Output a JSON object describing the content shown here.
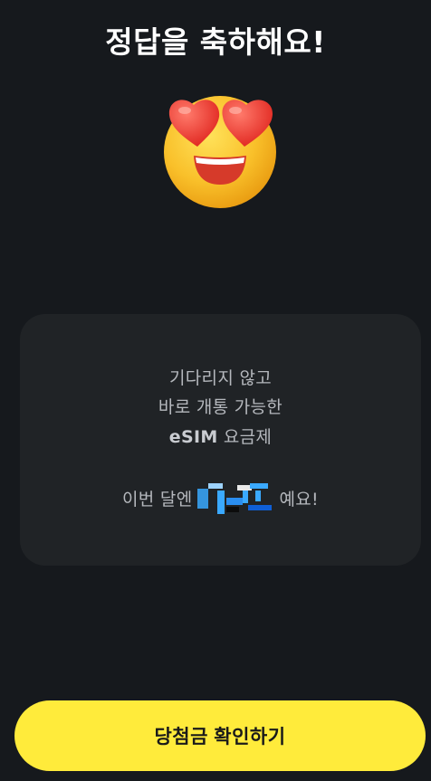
{
  "title": "정답을 축하해요!",
  "emoji": {
    "icon": "heart-eyes-emoji"
  },
  "card": {
    "line1": "기다리지 않고",
    "line2": "바로 개통 가능한",
    "line3_bold": "eSIM",
    "line3_rest": " 요금제",
    "line4_prefix": "이번 달엔 ",
    "line4_suffix": "예요!"
  },
  "cta": {
    "label": "당첨금 확인하기"
  },
  "colors": {
    "background": "#16191d",
    "card": "#202326",
    "cta": "#ffeb3b",
    "redacted": "#3aa9ff"
  }
}
